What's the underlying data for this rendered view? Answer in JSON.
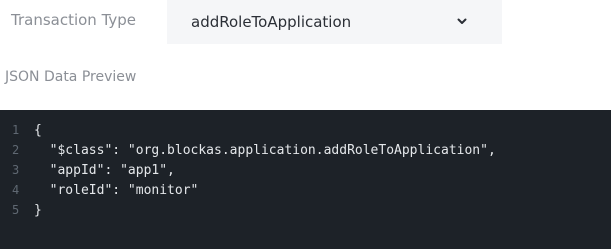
{
  "form": {
    "transaction_type_label": "Transaction Type",
    "transaction_type_value": "addRoleToApplication",
    "dropdown_icon": "chevron-down-icon",
    "json_preview_label": "JSON Data Preview"
  },
  "editor": {
    "line_numbers": [
      "1",
      "2",
      "3",
      "4",
      "5"
    ],
    "lines": [
      "{",
      "  \"$class\": \"org.blockas.application.addRoleToApplication\",",
      "  \"appId\": \"app1\",",
      "  \"roleId\": \"monitor\"",
      "}"
    ]
  },
  "colors": {
    "editor_background": "#1d2228",
    "select_background": "#f5f6f8",
    "label_text": "#8b8f96"
  }
}
